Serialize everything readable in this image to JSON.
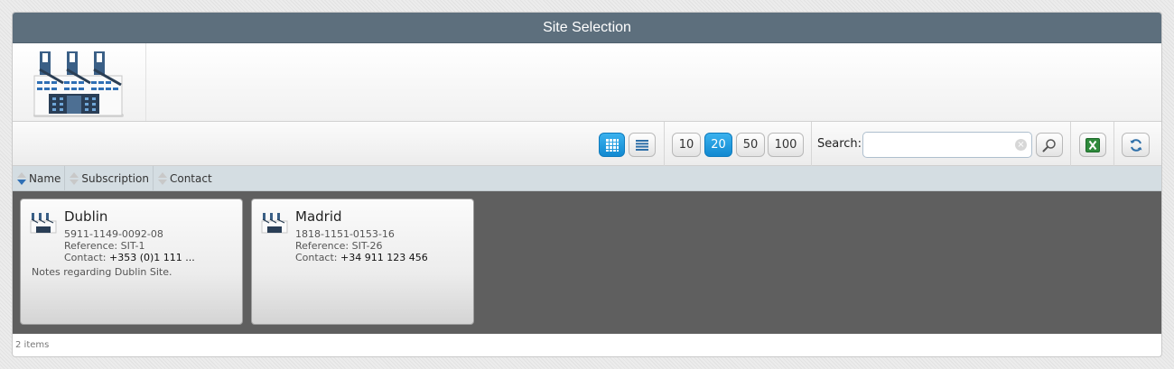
{
  "window": {
    "title": "Site Selection"
  },
  "toolbar": {
    "page_sizes": [
      "10",
      "20",
      "50",
      "100"
    ],
    "selected_page_size": "20",
    "search": {
      "label": "Search:",
      "value": "",
      "placeholder": ""
    },
    "view_modes": [
      "grid-view",
      "list-view"
    ],
    "selected_view": "grid-view"
  },
  "sort_columns": [
    {
      "label": "Name",
      "sorted": "descending"
    },
    {
      "label": "Subscription",
      "sorted": "none"
    },
    {
      "label": "Contact",
      "sorted": "none"
    }
  ],
  "sites": [
    {
      "name": "Dublin",
      "subscription": "5911-1149-0092-08",
      "reference_label": "Reference:",
      "reference": "SIT-1",
      "contact_label": "Contact:",
      "contact": "+353 (0)1 111 ...",
      "notes": "Notes regarding Dublin Site."
    },
    {
      "name": "Madrid",
      "subscription": "1818-1151-0153-16",
      "reference_label": "Reference:",
      "reference": "SIT-26",
      "contact_label": "Contact:",
      "contact": "+34 911 123 456",
      "notes": ""
    }
  ],
  "footer": {
    "item_count": "2 items"
  },
  "colors": {
    "titlebar": "#5d6f7d",
    "accent": "#1a95dd",
    "cards_background": "#5f5f5f",
    "sortbar": "#d4dde2"
  },
  "icons": [
    "factory-icon",
    "grid-icon",
    "list-icon",
    "magnifier-icon",
    "excel-icon",
    "refresh-icon",
    "clear-icon",
    "sort-arrow-icon"
  ]
}
